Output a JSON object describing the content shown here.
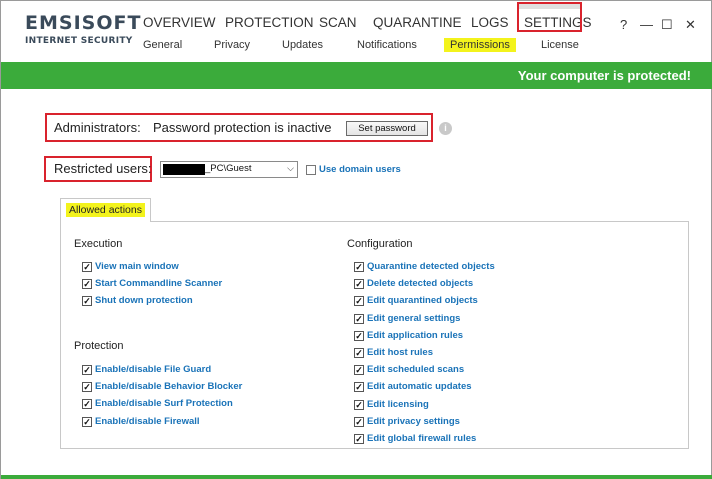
{
  "app": {
    "logo_main": "EMSISOFT",
    "logo_sub": "INTERNET SECURITY"
  },
  "main_nav": [
    "OVERVIEW",
    "PROTECTION",
    "SCAN",
    "QUARANTINE",
    "LOGS",
    "SETTINGS"
  ],
  "window_controls": [
    "?",
    "—",
    "☐",
    "✕"
  ],
  "sub_nav": [
    "General",
    "Privacy",
    "Updates",
    "Notifications",
    "Permissions",
    "License"
  ],
  "sub_nav_active": "Permissions",
  "status": "Your computer is protected!",
  "admin": {
    "label": "Administrators:",
    "state": "Password protection is inactive",
    "button": "Set password",
    "info_icon": "i"
  },
  "restricted": {
    "label": "Restricted users:",
    "selected_value": "_PC\\Guest",
    "caret": "⌵",
    "use_domain_label": "Use domain users"
  },
  "allowed_actions": {
    "tab_label": "Allowed actions",
    "execution": {
      "title": "Execution",
      "items": [
        "View main window",
        "Start Commandline Scanner",
        "Shut down protection"
      ]
    },
    "protection": {
      "title": "Protection",
      "items": [
        "Enable/disable File Guard",
        "Enable/disable Behavior Blocker",
        "Enable/disable Surf Protection",
        "Enable/disable Firewall"
      ]
    },
    "configuration": {
      "title": "Configuration",
      "items": [
        "Quarantine detected objects",
        "Delete detected objects",
        "Edit quarantined objects",
        "Edit general settings",
        "Edit application rules",
        "Edit host rules",
        "Edit scheduled scans",
        "Edit automatic updates",
        "Edit licensing",
        "Edit privacy settings",
        "Edit global firewall rules"
      ]
    },
    "check_mark": "✓"
  },
  "colors": {
    "accent_green": "#3bab3b",
    "link_blue": "#1a73b8",
    "highlight_yellow": "#f3f31c",
    "annotation_red": "#d9232d"
  }
}
